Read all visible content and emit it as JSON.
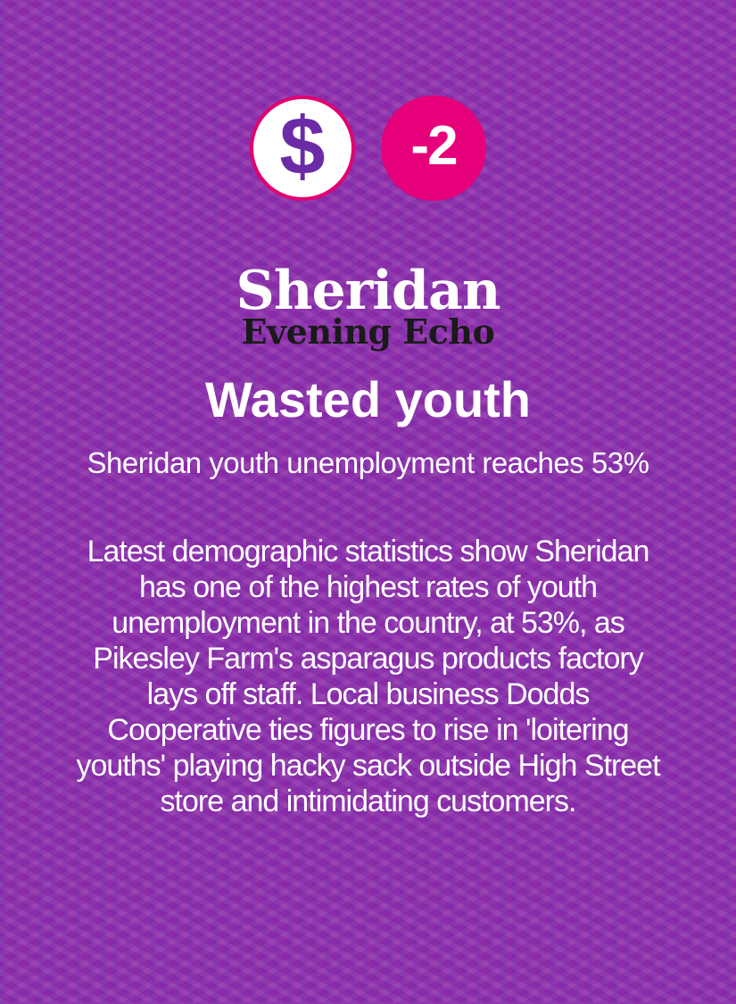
{
  "colors": {
    "background": "#8a2aa6",
    "badge_pink": "#e6007a",
    "badge_white": "#ffffff",
    "dollar_purple": "#6b2aa6",
    "masthead_dark": "#1a1a1a"
  },
  "badges": {
    "money": {
      "icon": "dollar-icon",
      "glyph": "$"
    },
    "delta": {
      "label": "-2"
    }
  },
  "masthead": {
    "line1": "Sheridan",
    "line2": "Evening Echo"
  },
  "article": {
    "headline": "Wasted youth",
    "subheadline": "Sheridan youth unemployment reaches 53%",
    "body": "Latest demographic statistics show Sheridan has one of the highest rates of youth unemployment in the country, at 53%, as Pikesley Farm's asparagus products factory lays off staff. Local business Dodds Cooperative ties figures to rise in 'loitering youths' playing hacky sack outside High Street store and intimidating customers."
  }
}
